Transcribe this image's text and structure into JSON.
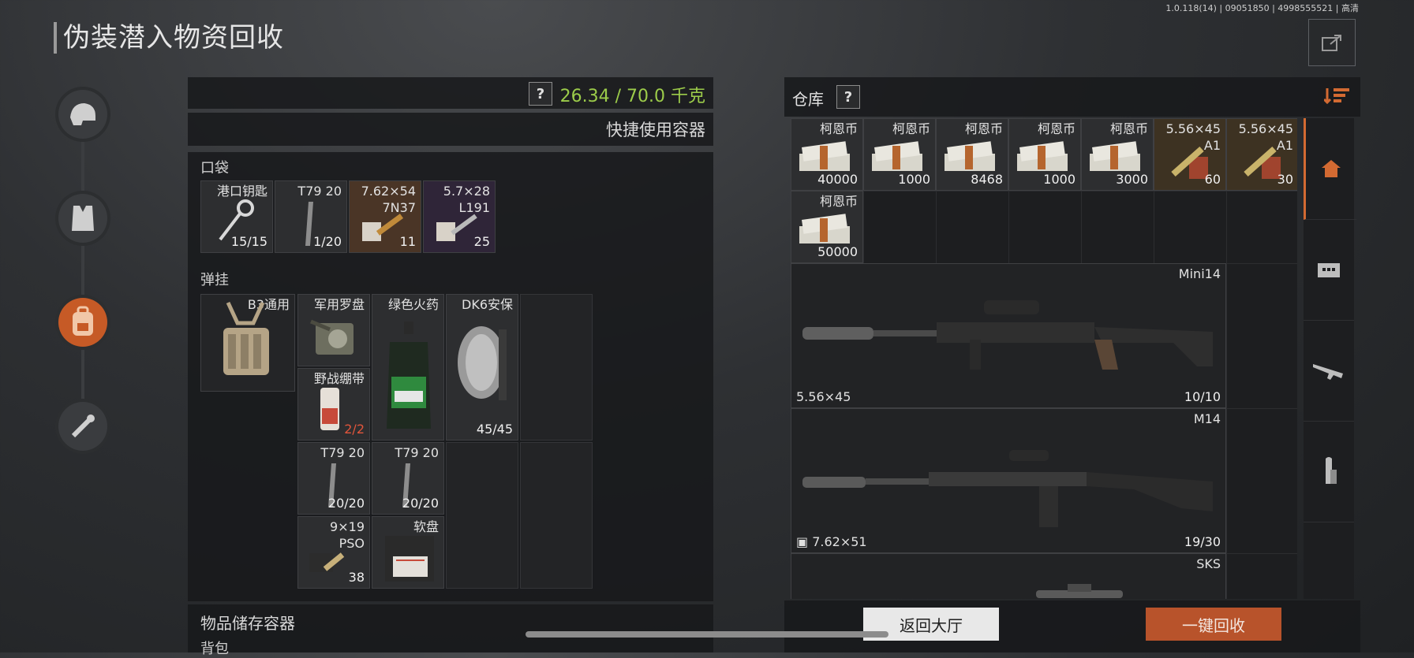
{
  "version_info": "1.0.118(14) | 09051850 | 4998555521 | 高清",
  "page_title": "伪装潜入物资回收",
  "weight": "26.34 / 70.0 千克",
  "help_label": "?",
  "quick_container": "快捷使用容器",
  "pocket": {
    "label": "口袋",
    "items": [
      {
        "name": "港口钥匙",
        "sub": "",
        "count": "15/15"
      },
      {
        "name": "T79 20",
        "sub": "",
        "count": "1/20"
      },
      {
        "name": "7.62×54",
        "sub": "7N37",
        "count": "11"
      },
      {
        "name": "5.7×28",
        "sub": "L191",
        "count": "25"
      }
    ]
  },
  "rig": {
    "label": "弹挂",
    "vest_name": "B3通用",
    "items": [
      {
        "name": "军用罗盘",
        "count": ""
      },
      {
        "name": "野战绷带",
        "count": "2/2"
      },
      {
        "name": "绿色火药",
        "count": ""
      },
      {
        "name": "DK6安保",
        "count": "45/45"
      },
      {
        "name": "T79 20",
        "count": "20/20"
      },
      {
        "name": "T79 20",
        "count": "20/20"
      },
      {
        "name": "9×19",
        "sub": "PSO",
        "count": "38"
      },
      {
        "name": "软盘",
        "count": ""
      }
    ]
  },
  "storage": {
    "label": "物品储存容器",
    "backpack_label": "背包"
  },
  "warehouse": {
    "label": "仓库",
    "money": [
      {
        "name": "柯恩币",
        "count": "40000"
      },
      {
        "name": "柯恩币",
        "count": "1000"
      },
      {
        "name": "柯恩币",
        "count": "8468"
      },
      {
        "name": "柯恩币",
        "count": "1000"
      },
      {
        "name": "柯恩币",
        "count": "3000"
      },
      {
        "name": "柯恩币",
        "count": "50000"
      }
    ],
    "ammo": [
      {
        "name": "5.56×45",
        "sub": "A1",
        "count": "60"
      },
      {
        "name": "5.56×45",
        "sub": "A1",
        "count": "30"
      }
    ],
    "weapons": [
      {
        "name": "Mini14",
        "caliber": "5.56×45",
        "count": "10/10"
      },
      {
        "name": "M14",
        "caliber": "7.62×51",
        "count": "19/30"
      },
      {
        "name": "SKS",
        "caliber": "",
        "count": ""
      }
    ]
  },
  "buttons": {
    "back": "返回大厅",
    "recycle": "一键回收"
  },
  "colors": {
    "accent": "#c65a26",
    "weight_green": "#9ccc4a",
    "alert_red": "#e2553b"
  }
}
